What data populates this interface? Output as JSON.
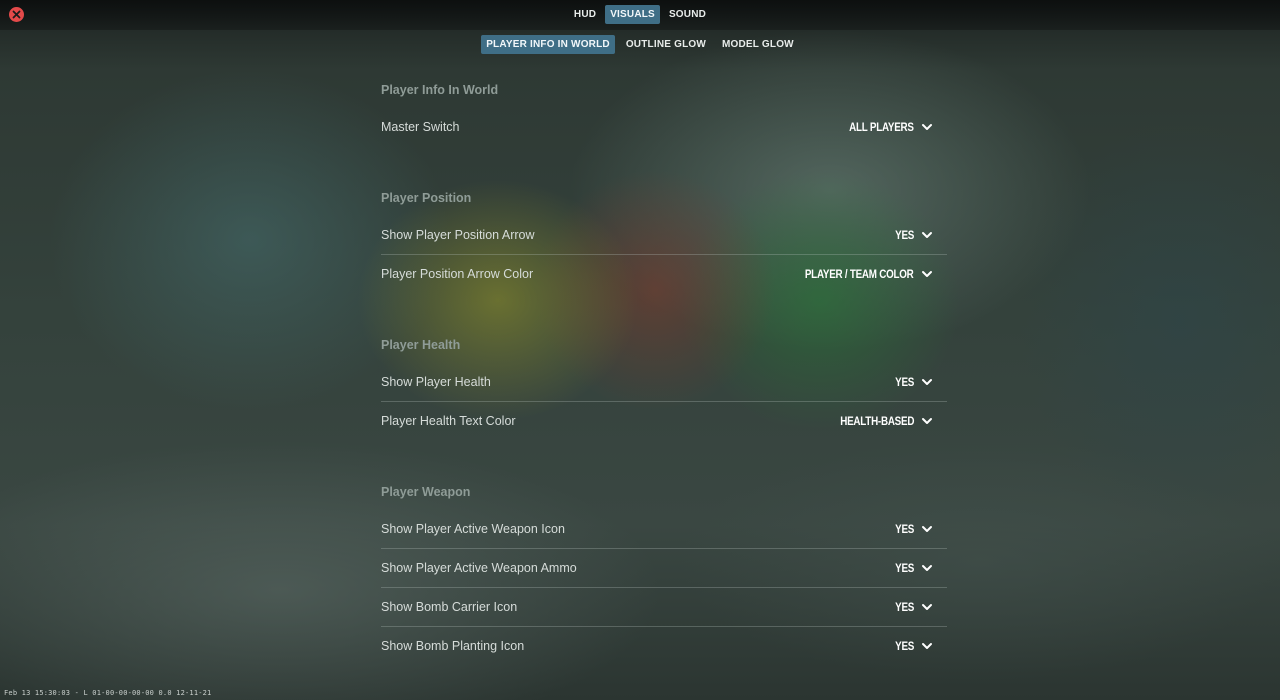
{
  "nav": {
    "tabs": [
      {
        "label": "HUD",
        "active": false
      },
      {
        "label": "VISUALS",
        "active": true
      },
      {
        "label": "SOUND",
        "active": false
      }
    ]
  },
  "subnav": {
    "tabs": [
      {
        "label": "PLAYER INFO IN WORLD",
        "active": true
      },
      {
        "label": "OUTLINE GLOW",
        "active": false
      },
      {
        "label": "MODEL GLOW",
        "active": false
      }
    ]
  },
  "sections": [
    {
      "title": "Player Info In World",
      "rows": [
        {
          "label": "Master Switch",
          "value": "ALL PLAYERS"
        }
      ]
    },
    {
      "title": "Player Position",
      "rows": [
        {
          "label": "Show Player Position Arrow",
          "value": "YES"
        },
        {
          "label": "Player Position Arrow Color",
          "value": "PLAYER / TEAM COLOR"
        }
      ]
    },
    {
      "title": "Player Health",
      "rows": [
        {
          "label": "Show Player Health",
          "value": "YES"
        },
        {
          "label": "Player Health Text Color",
          "value": "HEALTH-BASED"
        }
      ]
    },
    {
      "title": "Player Weapon",
      "rows": [
        {
          "label": "Show Player Active Weapon Icon",
          "value": "YES"
        },
        {
          "label": "Show Player Active Weapon Ammo",
          "value": "YES"
        },
        {
          "label": "Show Bomb Carrier Icon",
          "value": "YES"
        },
        {
          "label": "Show Bomb Planting Icon",
          "value": "YES"
        }
      ]
    }
  ],
  "footer": {
    "text": "Feb 13 15:30:03 - L 01-00-00-00-00 0.0 12-11-21"
  },
  "colors": {
    "active_tab": "#3f6e86",
    "close_button": "#e34a4a"
  }
}
